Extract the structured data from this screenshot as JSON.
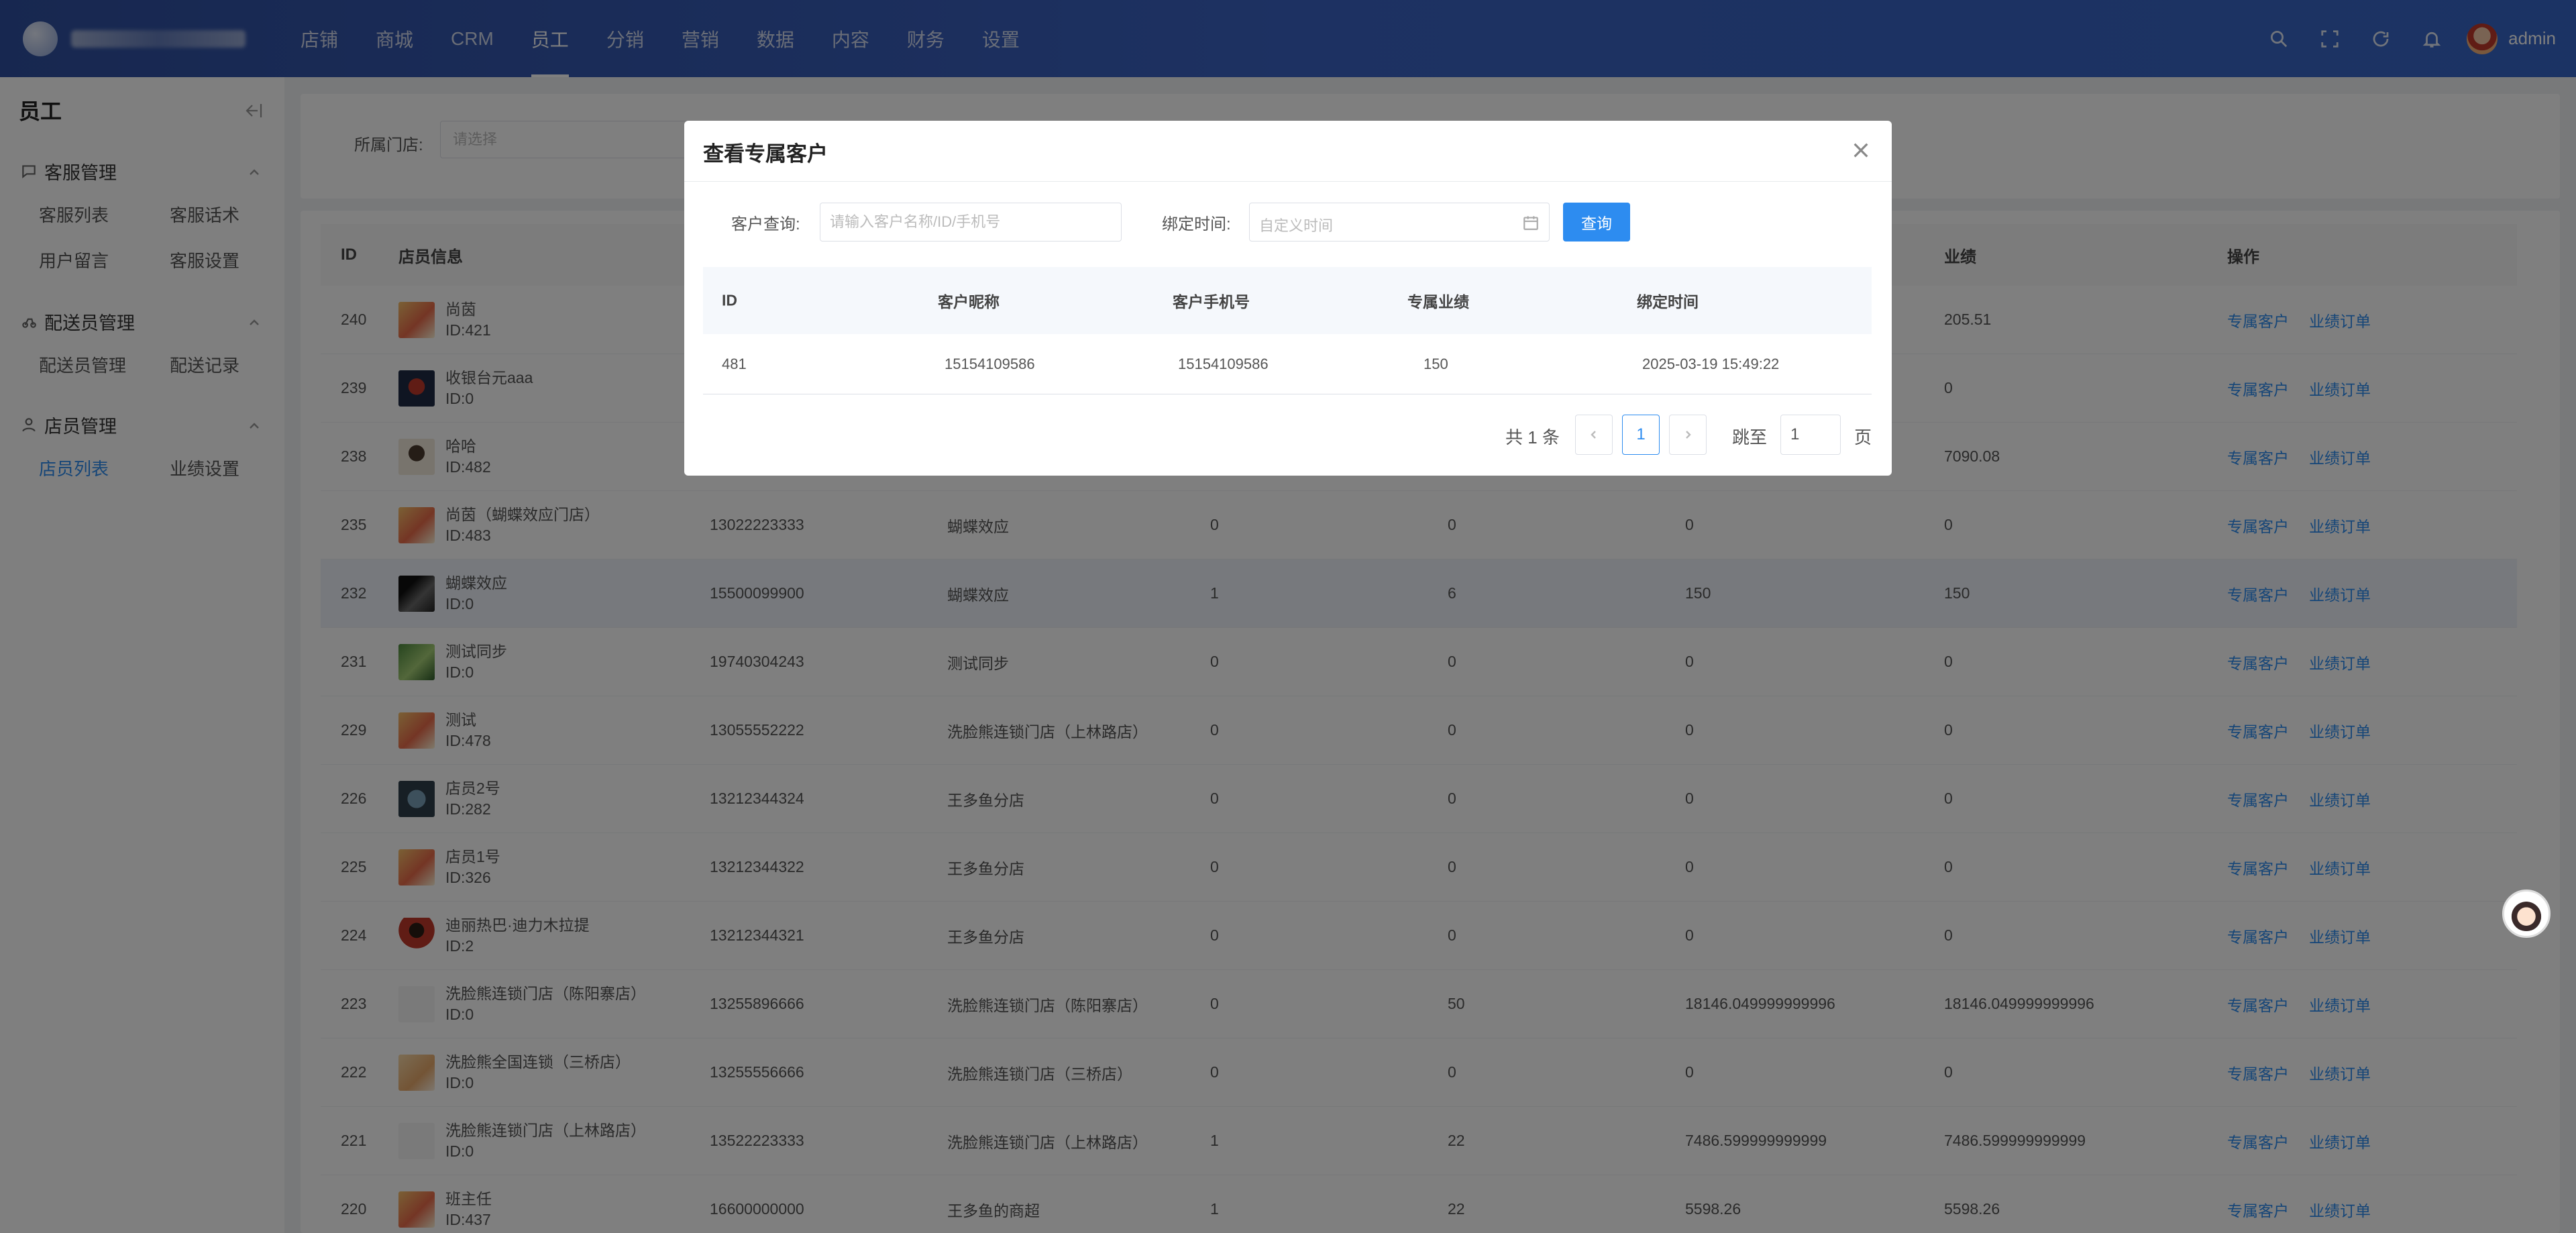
{
  "nav": {
    "items": [
      {
        "label": "店铺",
        "active": false
      },
      {
        "label": "商城",
        "active": false
      },
      {
        "label": "CRM",
        "active": false
      },
      {
        "label": "员工",
        "active": true
      },
      {
        "label": "分销",
        "active": false
      },
      {
        "label": "营销",
        "active": false
      },
      {
        "label": "数据",
        "active": false
      },
      {
        "label": "内容",
        "active": false
      },
      {
        "label": "财务",
        "active": false
      },
      {
        "label": "设置",
        "active": false
      }
    ],
    "user": "admin",
    "icons": [
      "search-icon",
      "fullscreen-icon",
      "refresh-icon",
      "bell-icon"
    ]
  },
  "sidebar": {
    "title": "员工",
    "groups": [
      {
        "label": "客服管理",
        "icon": "chat-icon",
        "items": [
          {
            "label": "客服列表"
          },
          {
            "label": "客服话术"
          },
          {
            "label": "用户留言"
          },
          {
            "label": "客服设置"
          }
        ]
      },
      {
        "label": "配送员管理",
        "icon": "delivery-icon",
        "items": [
          {
            "label": "配送员管理"
          },
          {
            "label": "配送记录"
          }
        ]
      },
      {
        "label": "店员管理",
        "icon": "user-icon",
        "items": [
          {
            "label": "店员列表",
            "active": true
          },
          {
            "label": "业绩设置"
          }
        ]
      }
    ]
  },
  "filter": {
    "label": "所属门店:",
    "placeholder": "请选择"
  },
  "table": {
    "headers": {
      "id": "ID",
      "info": "店员信息",
      "perf": "业绩",
      "op": "操作"
    },
    "op_labels": {
      "customers": "专属客户",
      "orders": "业绩订单"
    },
    "rows": [
      {
        "id": "240",
        "name": "尚茵",
        "uid": "ID:421",
        "phone": "",
        "store": "",
        "a": "",
        "b": "",
        "c": "",
        "d": "205.51",
        "thumb": "t1"
      },
      {
        "id": "239",
        "name": "收银台元aaa",
        "uid": "ID:0",
        "phone": "",
        "store": "",
        "a": "",
        "b": "",
        "c": "",
        "d": "0",
        "thumb": "t2"
      },
      {
        "id": "238",
        "name": "哈哈",
        "uid": "ID:482",
        "phone": "",
        "store": "",
        "a": "",
        "b": "",
        "c": "",
        "d": "7090.08",
        "thumb": "t3"
      },
      {
        "id": "235",
        "name": "尚茵（蝴蝶效应门店）",
        "uid": "ID:483",
        "phone": "13022223333",
        "store": "蝴蝶效应",
        "a": "0",
        "b": "0",
        "c": "0",
        "d": "0",
        "thumb": "t1"
      },
      {
        "id": "232",
        "name": "蝴蝶效应",
        "uid": "ID:0",
        "phone": "15500099900",
        "store": "蝴蝶效应",
        "a": "1",
        "b": "6",
        "c": "150",
        "d": "150",
        "thumb": "t4",
        "hl": true
      },
      {
        "id": "231",
        "name": "测试同步",
        "uid": "ID:0",
        "phone": "19740304243",
        "store": "测试同步",
        "a": "0",
        "b": "0",
        "c": "0",
        "d": "0",
        "thumb": "t5"
      },
      {
        "id": "229",
        "name": "测试",
        "uid": "ID:478",
        "phone": "13055552222",
        "store": "洗脸熊连锁门店（上林路店）",
        "a": "0",
        "b": "0",
        "c": "0",
        "d": "0",
        "thumb": "t1"
      },
      {
        "id": "226",
        "name": "店员2号",
        "uid": "ID:282",
        "phone": "13212344324",
        "store": "王多鱼分店",
        "a": "0",
        "b": "0",
        "c": "0",
        "d": "0",
        "thumb": "t6"
      },
      {
        "id": "225",
        "name": "店员1号",
        "uid": "ID:326",
        "phone": "13212344322",
        "store": "王多鱼分店",
        "a": "0",
        "b": "0",
        "c": "0",
        "d": "0",
        "thumb": "t1"
      },
      {
        "id": "224",
        "name": "迪丽热巴·迪力木拉提",
        "uid": "ID:2",
        "phone": "13212344321",
        "store": "王多鱼分店",
        "a": "0",
        "b": "0",
        "c": "0",
        "d": "0",
        "thumb": "t7"
      },
      {
        "id": "223",
        "name": "洗脸熊连锁门店（陈阳寨店）",
        "uid": "ID:0",
        "phone": "13255896666",
        "store": "洗脸熊连锁门店（陈阳寨店）",
        "a": "0",
        "b": "50",
        "c": "18146.049999999996",
        "d": "18146.049999999996",
        "thumb": "t8"
      },
      {
        "id": "222",
        "name": "洗脸熊全国连锁（三桥店）",
        "uid": "ID:0",
        "phone": "13255556666",
        "store": "洗脸熊连锁门店（三桥店）",
        "a": "0",
        "b": "0",
        "c": "0",
        "d": "0",
        "thumb": "t9"
      },
      {
        "id": "221",
        "name": "洗脸熊连锁门店（上林路店）",
        "uid": "ID:0",
        "phone": "13522223333",
        "store": "洗脸熊连锁门店（上林路店）",
        "a": "1",
        "b": "22",
        "c": "7486.599999999999",
        "d": "7486.599999999999",
        "thumb": "t8"
      },
      {
        "id": "220",
        "name": "班主任",
        "uid": "ID:437",
        "phone": "16600000000",
        "store": "王多鱼的商超",
        "a": "1",
        "b": "22",
        "c": "5598.26",
        "d": "5598.26",
        "thumb": "t1"
      }
    ]
  },
  "modal": {
    "title": "查看专属客户",
    "query_label": "客户查询:",
    "query_placeholder": "请输入客户名称/ID/手机号",
    "bind_label": "绑定时间:",
    "date_placeholder": "自定义时间",
    "query_button": "查询",
    "headers": [
      "ID",
      "客户昵称",
      "客户手机号",
      "专属业绩",
      "绑定时间"
    ],
    "rows": [
      {
        "id": "481",
        "nickname": "15154109586",
        "phone": "15154109586",
        "perf": "150",
        "time": "2025-03-19 15:49:22"
      }
    ],
    "pager": {
      "total": "共 1 条",
      "page": "1",
      "jump": "跳至",
      "jump_value": "1",
      "unit": "页"
    }
  }
}
